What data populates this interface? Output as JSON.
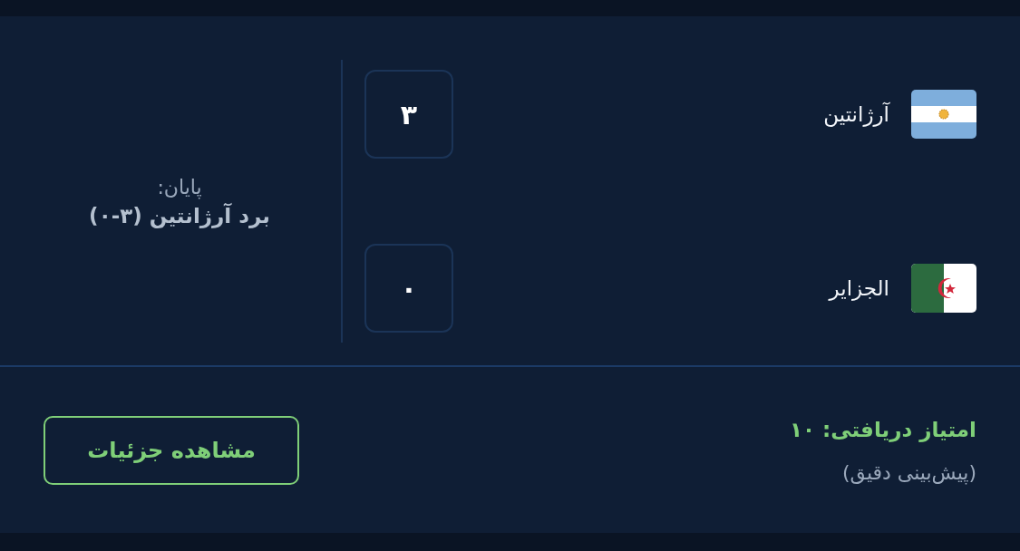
{
  "match": {
    "teams": [
      {
        "name": "آرژانتین",
        "score": "۳"
      },
      {
        "name": "الجزایر",
        "score": "۰"
      }
    ],
    "status": {
      "label": "پایان:",
      "result": "برد آرژانتین (۳-۰)"
    }
  },
  "prediction": {
    "points": "امتیاز دریافتی: ۱۰",
    "note": "(پیش‌بینی دقیق)"
  },
  "buttons": [
    "مشاهده جزئیات"
  ]
}
